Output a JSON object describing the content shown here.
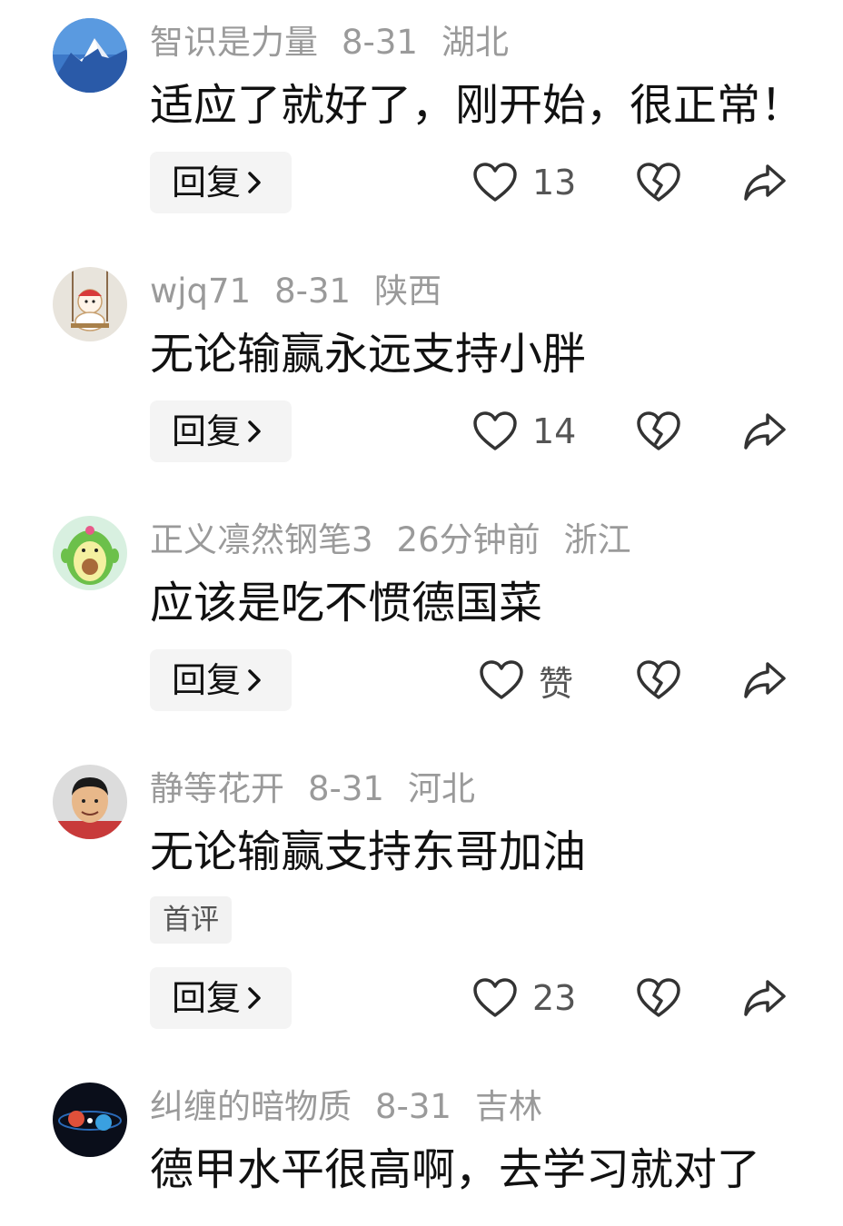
{
  "comments": [
    {
      "username": "智识是力量",
      "date": "8-31",
      "location": "湖北",
      "text": "适应了就好了，刚开始，很正常！",
      "reply_label": "回复",
      "likes": "13",
      "avatar_icon": "snow-mountain-avatar"
    },
    {
      "username": "wjq71",
      "date": "8-31",
      "location": "陕西",
      "text": "无论输赢永远支持小胖",
      "reply_label": "回复",
      "likes": "14",
      "avatar_icon": "cartoon-swing-avatar"
    },
    {
      "username": "正义凛然钢笔3",
      "date": "26分钟前",
      "location": "浙江",
      "text": "应该是吃不惯德国菜",
      "reply_label": "回复",
      "likes": "赞",
      "avatar_icon": "avocado-avatar"
    },
    {
      "username": "静等花开",
      "date": "8-31",
      "location": "河北",
      "text": "无论输赢支持东哥加油",
      "badge": "首评",
      "reply_label": "回复",
      "likes": "23",
      "avatar_icon": "person-photo-avatar"
    },
    {
      "username": "纠缠的暗物质",
      "date": "8-31",
      "location": "吉林",
      "text": "德甲水平很高啊，去学习就对了",
      "avatar_icon": "space-orbs-avatar"
    }
  ],
  "colors": {
    "meta_text": "#9a9a9a",
    "body_text": "#111111",
    "button_bg": "#f4f4f4",
    "icon_stroke": "#333333"
  }
}
